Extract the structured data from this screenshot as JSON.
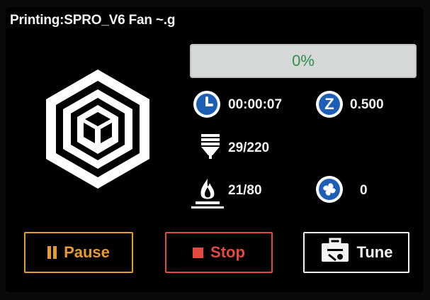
{
  "header": {
    "title": "Printing:SPRO_V6 Fan ~.g"
  },
  "progress": {
    "label": "0%",
    "fraction": 0
  },
  "stats": {
    "elapsed_time": "00:00:07",
    "z_height": "0.500",
    "nozzle_temp": "29/220",
    "bed_temp": "21/80",
    "fan_speed": "0"
  },
  "icons": {
    "logo": "cube-hexagon-logo",
    "clock": "clock-icon",
    "z": "z-axis-icon",
    "nozzle": "nozzle-icon",
    "bed": "heated-bed-icon",
    "fan": "fan-icon",
    "pause": "pause-icon",
    "stop": "stop-icon",
    "tune": "toolbox-icon"
  },
  "buttons": {
    "pause": "Pause",
    "stop": "Stop",
    "tune": "Tune"
  },
  "colors": {
    "pause": "#e79a2e",
    "stop": "#e24a3f",
    "tune": "#f4f4f4",
    "progress_text": "#2f8f47",
    "badge": "#1d5fb4"
  }
}
